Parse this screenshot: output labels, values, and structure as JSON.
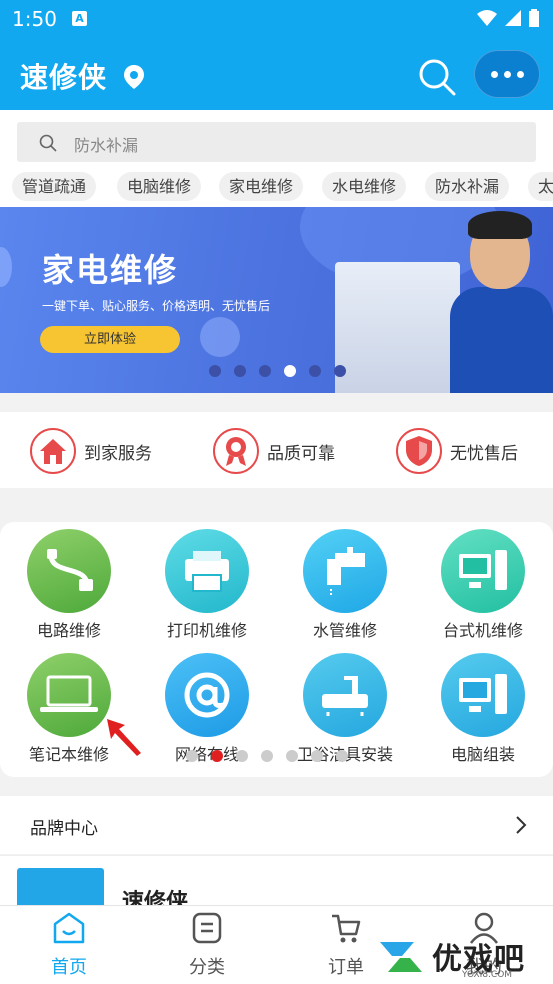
{
  "status": {
    "time": "1:50",
    "notif_letter": "A"
  },
  "appbar": {
    "title": "速修侠"
  },
  "search": {
    "placeholder": "防水补漏"
  },
  "tags": [
    "管道疏通",
    "电脑维修",
    "家电维修",
    "水电维修",
    "防水补漏",
    "太"
  ],
  "banner": {
    "heading": "家电维修",
    "subheading": "一键下单、贴心服务、价格透明、无忧售后",
    "button": "立即体验",
    "dots_count": 6,
    "active_dot": 3
  },
  "features": [
    {
      "label": "到家服务",
      "icon": "house-icon"
    },
    {
      "label": "品质可靠",
      "icon": "award-ribbon-icon"
    },
    {
      "label": "无忧售后",
      "icon": "shield-icon"
    }
  ],
  "services": [
    {
      "label": "电路维修",
      "icon": "plug-cable-icon",
      "color_a": "#8fd06a",
      "color_b": "#4ea93a"
    },
    {
      "label": "打印机维修",
      "icon": "printer-icon",
      "color_a": "#5fdce6",
      "color_b": "#22b7cc"
    },
    {
      "label": "水管维修",
      "icon": "faucet-icon",
      "color_a": "#53d1f5",
      "color_b": "#1fa7e6"
    },
    {
      "label": "台式机维修",
      "icon": "desktop-computer-icon",
      "color_a": "#63e0c3",
      "color_b": "#22bfa2"
    },
    {
      "label": "笔记本维修",
      "icon": "laptop-icon",
      "color_a": "#8fd06a",
      "color_b": "#4ea93a"
    },
    {
      "label": "网络布线",
      "icon": "at-sign-icon",
      "color_a": "#4cc0f6",
      "color_b": "#1e9be6"
    },
    {
      "label": "卫浴洁具安装",
      "icon": "bathtub-icon",
      "color_a": "#55cbee",
      "color_b": "#25a7df"
    },
    {
      "label": "电脑组装",
      "icon": "computer-icon",
      "color_a": "#55cbee",
      "color_b": "#25a7df"
    }
  ],
  "services_pager": {
    "dots_count": 7,
    "active_dot": 1
  },
  "brand": {
    "title": "品牌中心",
    "card_name": "速修侠"
  },
  "tabbar": [
    {
      "label": "首页",
      "icon": "home-smile-icon",
      "active": true
    },
    {
      "label": "分类",
      "icon": "list-doc-icon",
      "active": false
    },
    {
      "label": "订单",
      "icon": "cart-icon",
      "active": false
    },
    {
      "label": "我的",
      "icon": "user-icon",
      "active": false
    }
  ],
  "watermark": {
    "text": "优戏吧",
    "sub": "YOXI8.COM"
  },
  "colors": {
    "primary": "#12a8f0",
    "accent_red": "#e74a4a",
    "tab_active": "#12a8f0"
  }
}
